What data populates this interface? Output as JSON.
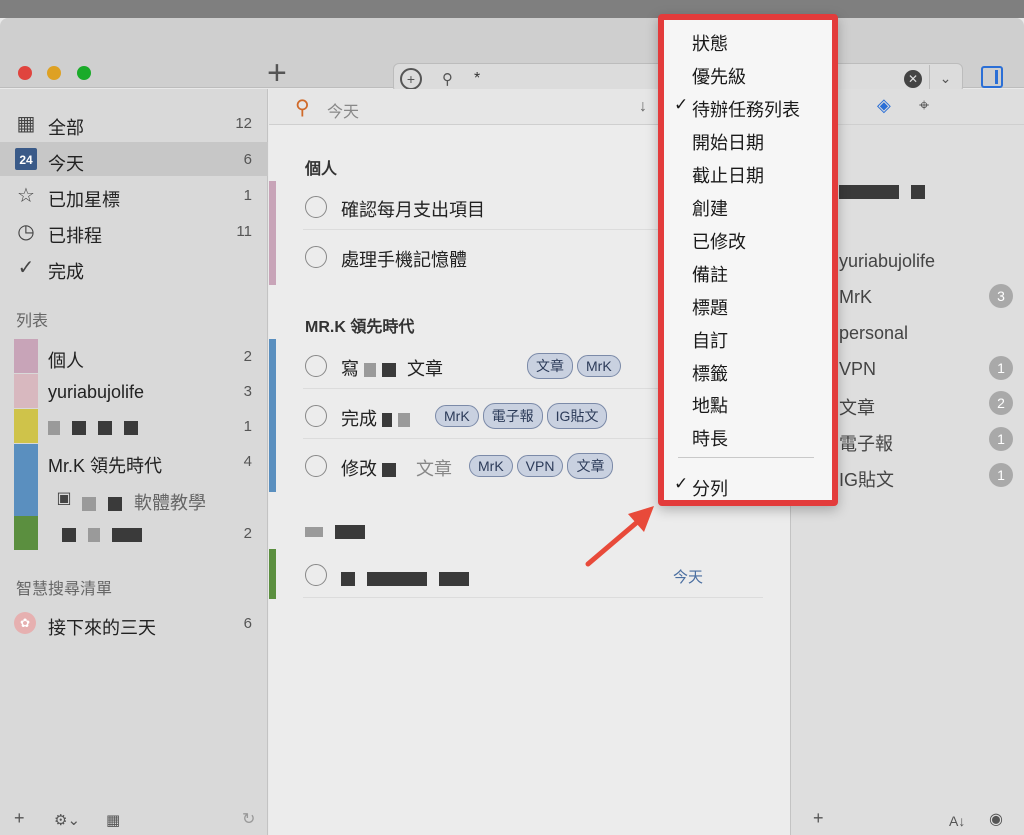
{
  "toolbar": {
    "add_label": "+",
    "search_text": "*"
  },
  "sidebar": {
    "items": [
      {
        "label": "全部",
        "count": "12"
      },
      {
        "label": "今天",
        "count": "6",
        "icon_text": "24"
      },
      {
        "label": "已加星標",
        "count": "1"
      },
      {
        "label": "已排程",
        "count": "11"
      },
      {
        "label": "完成",
        "count": ""
      }
    ],
    "lists_heading": "列表",
    "lists": [
      {
        "label": "個人",
        "count": "2"
      },
      {
        "label": "yuriabujolife",
        "count": "3"
      },
      {
        "label": "",
        "count": "1"
      },
      {
        "label": "Mr.K 領先時代",
        "count": "4"
      },
      {
        "label": "軟體教學",
        "count": ""
      },
      {
        "label": "",
        "count": "2"
      }
    ],
    "smart_heading": "智慧搜尋清單",
    "smart": [
      {
        "label": "接下來的三天",
        "count": "6"
      }
    ]
  },
  "main": {
    "search_label": "今天",
    "groups": [
      {
        "title": "個人"
      },
      {
        "title": "MR.K 領先時代"
      }
    ],
    "tasks": [
      {
        "title": "確認每月支出項目"
      },
      {
        "title": "處理手機記憶體"
      },
      {
        "title_a": "寫",
        "title_b": "文章",
        "tags": [
          "文章",
          "MrK"
        ]
      },
      {
        "title_a": "完成",
        "tags": [
          "MrK",
          "電子報",
          "IG貼文"
        ]
      },
      {
        "title_a": "修改",
        "title_b": "文章",
        "tags": [
          "MrK",
          "VPN",
          "文章"
        ]
      },
      {
        "due": "今天"
      }
    ]
  },
  "inspector": {
    "tags": [
      {
        "label": "yuriabujolife",
        "count": ""
      },
      {
        "label": "MrK",
        "count": "3"
      },
      {
        "label": "personal",
        "count": ""
      },
      {
        "label": "VPN",
        "count": "1"
      },
      {
        "label": "文章",
        "count": "2"
      },
      {
        "label": "電子報",
        "count": "1"
      },
      {
        "label": "IG貼文",
        "count": "1"
      }
    ]
  },
  "menu": {
    "items": [
      {
        "label": "狀態",
        "checked": false
      },
      {
        "label": "優先級",
        "checked": false
      },
      {
        "label": "待辦任務列表",
        "checked": true
      },
      {
        "label": "開始日期",
        "checked": false
      },
      {
        "label": "截止日期",
        "checked": false
      },
      {
        "label": "創建",
        "checked": false
      },
      {
        "label": "已修改",
        "checked": false
      },
      {
        "label": "備註",
        "checked": false
      },
      {
        "label": "標題",
        "checked": false
      },
      {
        "label": "自訂",
        "checked": false
      },
      {
        "label": "標籤",
        "checked": false
      },
      {
        "label": "地點",
        "checked": false
      },
      {
        "label": "時長",
        "checked": false
      }
    ],
    "columns_label": "分列",
    "check_mark": "✓"
  },
  "colors": {
    "highlight_border": "#e33b3b",
    "accent": "#2b6fd6"
  }
}
